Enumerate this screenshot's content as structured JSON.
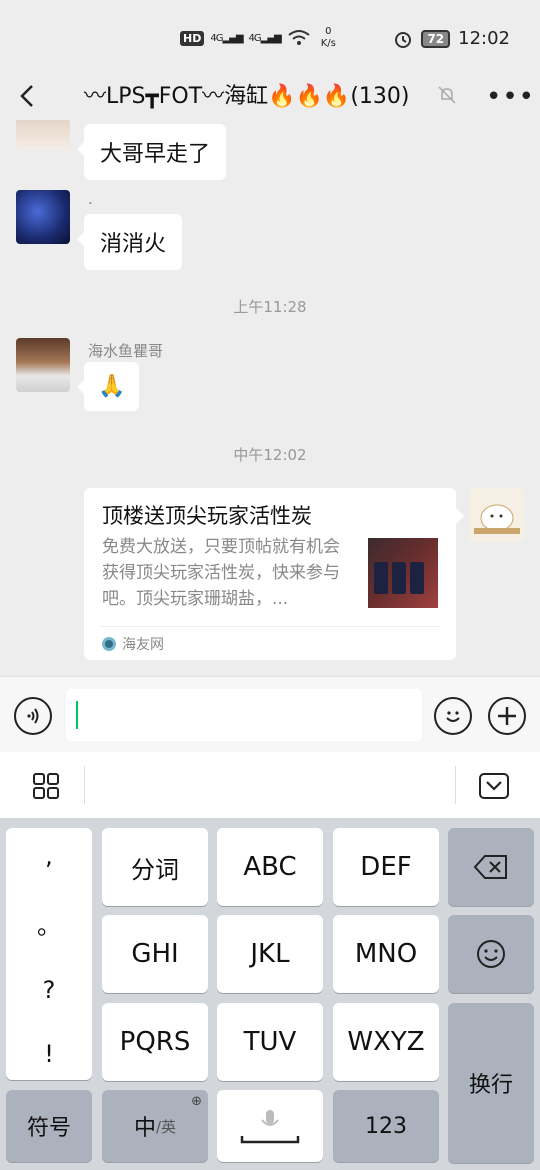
{
  "status_bar": {
    "hd": "HD",
    "sig1": "4G",
    "sig2": "4G",
    "speed_value": "0",
    "speed_unit": "K/s",
    "battery": "72",
    "time": "12:02"
  },
  "header": {
    "title": "〰LPS┳FOT〰海缸🔥🔥🔥(130)"
  },
  "chat": {
    "messages": [
      {
        "sender": "",
        "text": "大哥早走了"
      },
      {
        "sender": ".",
        "text": "消消火"
      },
      {
        "time": "上午11:28"
      },
      {
        "sender": "海水鱼瞿哥",
        "text": "🙏"
      },
      {
        "time": "中午12:02"
      }
    ],
    "card": {
      "title": "顶楼送顶尖玩家活性炭",
      "desc": "免费大放送，只要顶帖就有机会获得顶尖玩家活性炭，快来参与吧。顶尖玩家珊瑚盐，...",
      "source": "海友网"
    }
  },
  "keyboard": {
    "punct": [
      ",",
      "。",
      "?",
      "!"
    ],
    "row1": [
      "分词",
      "ABC",
      "DEF"
    ],
    "row2": [
      "GHI",
      "JKL",
      "MNO"
    ],
    "row3": [
      "PQRS",
      "TUV",
      "WXYZ"
    ],
    "symbols": "符号",
    "lang_main": "中",
    "lang_sub": "/英",
    "num": "123",
    "enter": "换行"
  },
  "colors": {
    "accent": "#07c160",
    "chat_bg": "#ededed",
    "keyboard_bg": "#d3d6db",
    "dark_key": "#abb2bd"
  }
}
